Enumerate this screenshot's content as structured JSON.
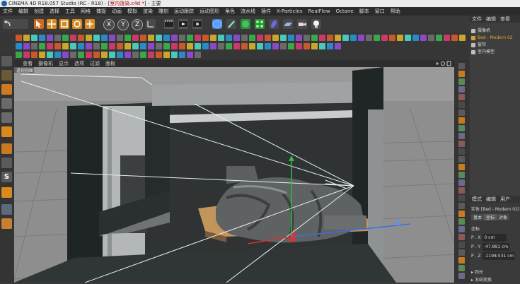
{
  "window": {
    "title_prefix": "CINEMA 4D R18.057 Studio (RC - R18) - [",
    "title_file": "室内渲染.c4d *",
    "title_suffix": "] - 主要"
  },
  "menu": [
    "文件",
    "编辑",
    "创建",
    "选择",
    "工具",
    "网格",
    "捕捉",
    "动画",
    "模拟",
    "渲染",
    "雕刻",
    "运动跟踪",
    "运动图形",
    "角色",
    "流水线",
    "插件",
    "X-Particles",
    "RealFlow",
    "Octane",
    "脚本",
    "窗口",
    "帮助"
  ],
  "viewport": {
    "menu": [
      "查看",
      "摄像机",
      "显示",
      "选项",
      "过滤",
      "面板"
    ],
    "label": "透视视图"
  },
  "object_manager": {
    "tabs": [
      "文件",
      "编辑",
      "查看"
    ],
    "objects": [
      {
        "name": "摄像机",
        "color": "#bfbfbf",
        "selected": false
      },
      {
        "name": "Bed - Modern 02",
        "color": "#d9a030",
        "selected": true
      },
      {
        "name": "窗帘",
        "color": "#bfbfbf",
        "selected": false
      },
      {
        "name": "室内模型",
        "color": "#bfbfbf",
        "selected": false
      }
    ]
  },
  "attributes": {
    "tabs": [
      "模式",
      "编辑",
      "用户"
    ],
    "object_title": "实体 [Bed - Modern 02]",
    "subtabs": [
      "基本",
      "坐标",
      "对象"
    ],
    "section": "坐标",
    "fields": [
      {
        "label": "P . X",
        "value": "0 cm"
      },
      {
        "label": "P . Y",
        "value": "-47.891 cm"
      },
      {
        "label": "P . Z",
        "value": "-1198.531 cm"
      }
    ],
    "groups": [
      "▸ 四元",
      "▸ 冻结变换"
    ]
  },
  "icons": {
    "undo": "undo-icon",
    "select": "live-select-icon",
    "move": "move-icon",
    "scale": "scale-icon",
    "rotate": "rotate-icon",
    "axis_x": "X",
    "axis_y": "Y",
    "axis_z": "Z",
    "world": "coordinate-system-icon",
    "render_view": "render-view-icon",
    "render": "render-icon",
    "render_settings": "render-settings-icon",
    "cube": "cube-icon",
    "spline": "pen-icon",
    "subdivision": "subdivision-icon",
    "array": "array-icon",
    "deformer": "deformer-icon",
    "floor": "floor-icon",
    "camera": "camera-icon",
    "light": "light-icon"
  },
  "colors": {
    "accent_orange": "#e09020",
    "selected_object": "#d9a030",
    "axis_red": "#d83030",
    "axis_green": "#2fbf3f",
    "axis_blue": "#3a6fe0"
  }
}
